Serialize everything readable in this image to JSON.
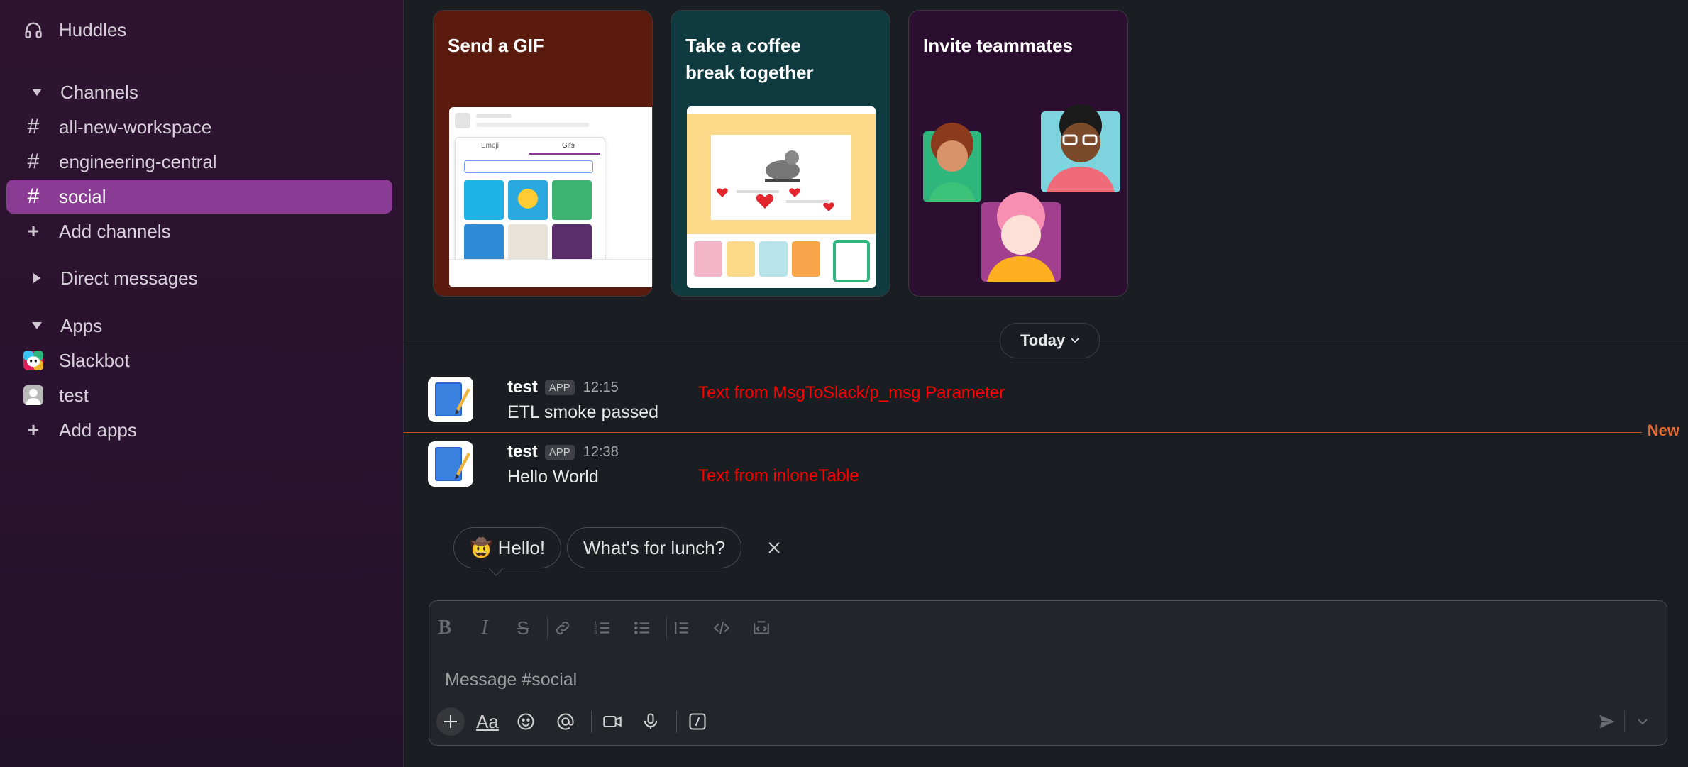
{
  "sidebar": {
    "huddles_label": "Huddles",
    "channels_header": "Channels",
    "channels": [
      {
        "label": "all-new-workspace"
      },
      {
        "label": "engineering-central"
      },
      {
        "label": "social"
      }
    ],
    "add_channels_label": "Add channels",
    "direct_messages_header": "Direct messages",
    "apps_header": "Apps",
    "apps": [
      {
        "label": "Slackbot"
      },
      {
        "label": "test"
      }
    ],
    "add_apps_label": "Add apps"
  },
  "cards": [
    {
      "title": "Send a GIF",
      "color": "#5a1a0e"
    },
    {
      "title": "Take a coffee break together",
      "title_line1": "Take a coffee",
      "title_line2": "break together",
      "color": "#0f3a40"
    },
    {
      "title": "Invite teammates",
      "color": "#2c0f30"
    }
  ],
  "gif_picker": {
    "tab_emoji": "Emoji",
    "tab_gifs": "Gifs"
  },
  "today_label": "Today",
  "messages": [
    {
      "name": "test",
      "badge": "APP",
      "time": "12:15",
      "text": "ETL smoke passed",
      "note": "Text from MsgToSlack/p_msg Parameter"
    },
    {
      "name": "test",
      "badge": "APP",
      "time": "12:38",
      "text": "Hello World",
      "note": "Text from inloneTable"
    }
  ],
  "new_label": "New",
  "suggestions": [
    {
      "label": "🤠 Hello!"
    },
    {
      "label": "What's for lunch?"
    }
  ],
  "composer": {
    "placeholder": "Message #social"
  },
  "colors": {
    "accent_active": "#8a3b93",
    "new_line": "#e8692e",
    "note_red": "#ff0000"
  }
}
